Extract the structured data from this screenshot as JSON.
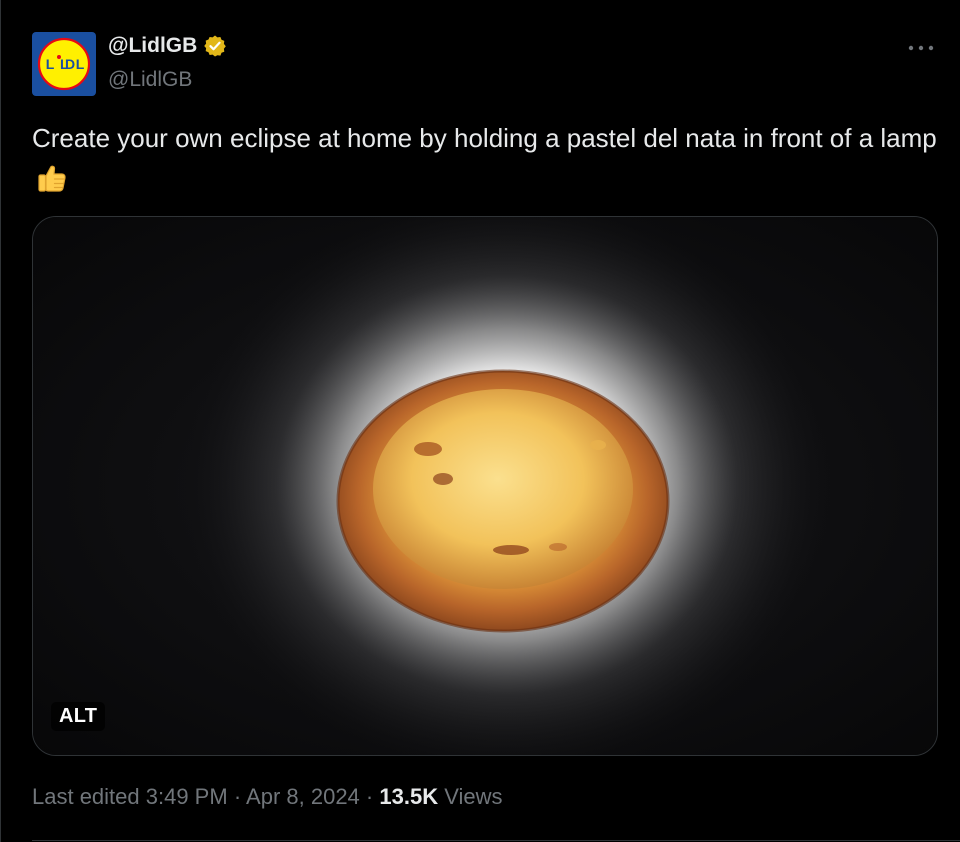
{
  "account": {
    "display_name": "@LidlGB",
    "handle": "@LidlGB",
    "avatar_logo_text": "LiDL"
  },
  "tweet": {
    "text": "Create your own eclipse at home by holding a pastel del nata in front of a lamp",
    "emoji": "thumbs-up"
  },
  "media": {
    "alt_label": "ALT"
  },
  "meta": {
    "edited_time": "Last edited 3:49 PM",
    "separator": "·",
    "date": "Apr 8, 2024",
    "views_count": "13.5K",
    "views_label": "Views"
  },
  "colors": {
    "background": "#000000",
    "text_primary": "#e7e9ea",
    "text_secondary": "#71767b",
    "verified_badge": "#e2b719",
    "border": "#2f3336",
    "lidl_blue": "#1a4fa0",
    "lidl_yellow": "#fff000",
    "lidl_red": "#e60a14"
  }
}
